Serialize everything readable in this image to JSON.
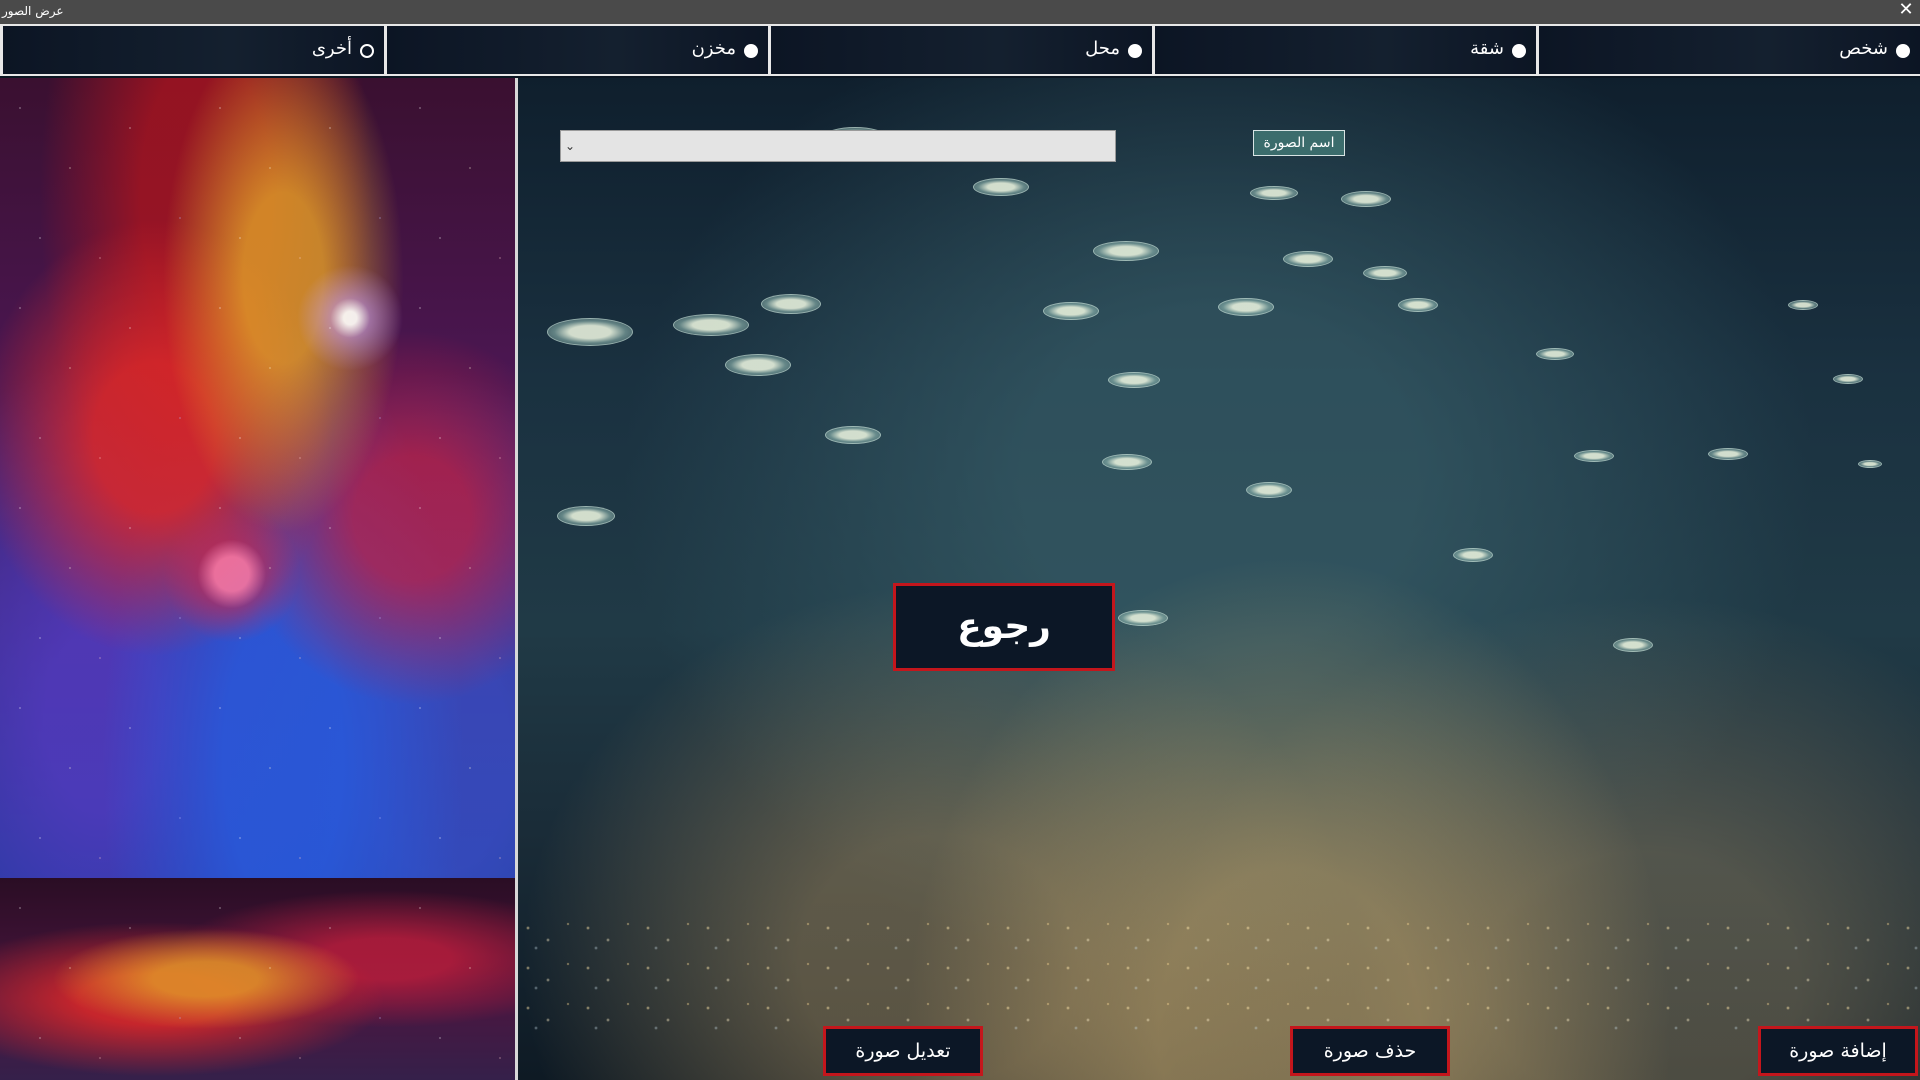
{
  "window": {
    "title": "عرض الصور",
    "close_glyph": "✕"
  },
  "tabs": [
    {
      "label": "شخص",
      "selected": true
    },
    {
      "label": "شقة",
      "selected": true
    },
    {
      "label": "محل",
      "selected": true
    },
    {
      "label": "مخزن",
      "selected": true
    },
    {
      "label": "أخرى",
      "selected": false
    }
  ],
  "image_name": {
    "label": "اسم الصورة",
    "value": "",
    "dropdown_icon": "chevron-down-icon"
  },
  "buttons": {
    "back": "رجوع",
    "edit": "تعديل صورة",
    "delete": "حذف صورة",
    "add": "إضافة صورة"
  },
  "colors": {
    "button_border": "#c4161c",
    "button_bg": "#0c1726",
    "label_bg": "#3b6c6c",
    "title_bar": "#4a4a4a"
  }
}
